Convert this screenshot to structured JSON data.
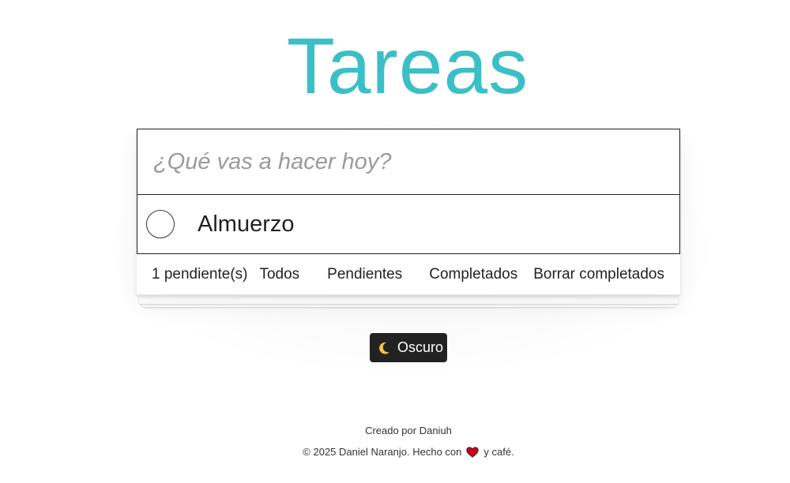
{
  "header": {
    "title": "Tareas"
  },
  "new_todo": {
    "placeholder": "¿Qué vas a hacer hoy?",
    "value": ""
  },
  "todos": [
    {
      "label": "Almuerzo",
      "completed": false
    }
  ],
  "footer": {
    "count_label": "1 pendiente(s)",
    "filters": [
      "Todos",
      "Pendientes",
      "Completados"
    ],
    "clear_label": "Borrar completados"
  },
  "theme_toggle": {
    "icon": "moon-icon",
    "label": "Oscuro"
  },
  "credits": {
    "line1": "Creado por Daniuh",
    "line2_prefix": "© 2025 Daniel Naranjo. Hecho con",
    "line2_icon": "heart-icon",
    "line2_suffix": "y café."
  },
  "colors": {
    "accent": "#3bbfc6",
    "button_bg": "#222222",
    "heart": "#d0021b"
  }
}
